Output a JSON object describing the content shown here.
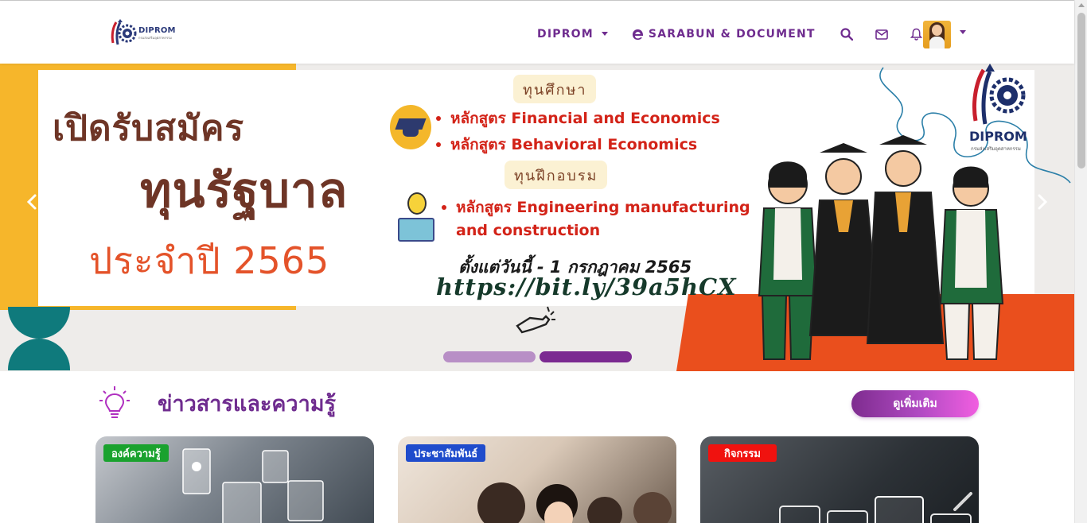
{
  "navbar": {
    "logo_text": "DIPROM",
    "logo_subtext": "กรมส่งเสริมอุตสาหกรรม",
    "menu": [
      {
        "label": "DIPROM"
      },
      {
        "label": "SARABUN & DOCUMENT"
      }
    ],
    "icons": [
      "search-icon",
      "mail-icon",
      "bell-icon"
    ],
    "avatar_alt": "user avatar"
  },
  "hero": {
    "title_line1": "เปิดรับสมัคร",
    "title_line2": "ทุนรัฐบาล",
    "title_line3": "ประจำปี 2565",
    "tag_scholarship": "ทุนศึกษา",
    "course1": "หลักสูตร Financial and Economics",
    "course2": "หลักสูตร Behavioral Economics",
    "tag_training": "ทุนฝึกอบรม",
    "course3_line1": "หลักสูตร Engineering manufacturing",
    "course3_line2": "and construction",
    "date_text": "ตั้งแต่วันนี้ - 1 กรกฎาคม 2565",
    "url_text": "https://bit.ly/39a5hCX",
    "brand_name": "DIPROM",
    "brand_sub": "กรมส่งเสริมอุตสาหกรรม",
    "active_slide": 2,
    "slide_count": 2
  },
  "news": {
    "title": "ข่าวสารและความรู้",
    "more_label": "ดูเพิ่มเติม",
    "cards": [
      {
        "tag": "องค์ความรู้",
        "tag_color": "#1aa22e"
      },
      {
        "tag": "ประชาสัมพันธ์",
        "tag_color": "#1f4ccc"
      },
      {
        "tag": "กิจกรรม",
        "tag_color": "#f0120f"
      }
    ]
  },
  "colors": {
    "brand_purple": "#6f2c8f",
    "hero_brown": "#6e3526",
    "hero_orange": "#e4532a",
    "hero_yellow": "#f6b62b",
    "hero_teal": "#0f7a7c"
  }
}
